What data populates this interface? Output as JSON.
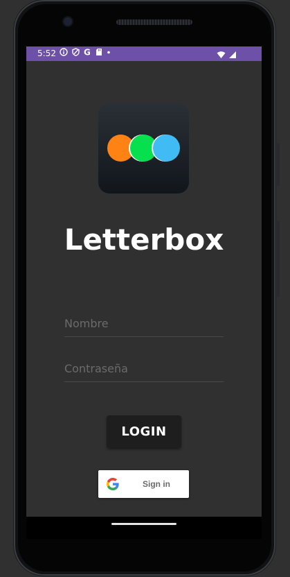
{
  "status_bar": {
    "time": "5:52",
    "icons": [
      "info-icon",
      "shield-icon",
      "google-g-icon",
      "sd-card-icon",
      "dot-icon"
    ],
    "right_icons": [
      "wifi-icon",
      "signal-icon"
    ],
    "color": "#6d51a8"
  },
  "app": {
    "title": "Letterbox",
    "logo_colors": [
      "#ff8214",
      "#06e04f",
      "#40bbf4"
    ]
  },
  "form": {
    "username_placeholder": "Nombre",
    "username_value": "",
    "password_placeholder": "Contraseña",
    "password_value": ""
  },
  "buttons": {
    "login_label": "LOGIN",
    "google_label": "Sign in"
  }
}
